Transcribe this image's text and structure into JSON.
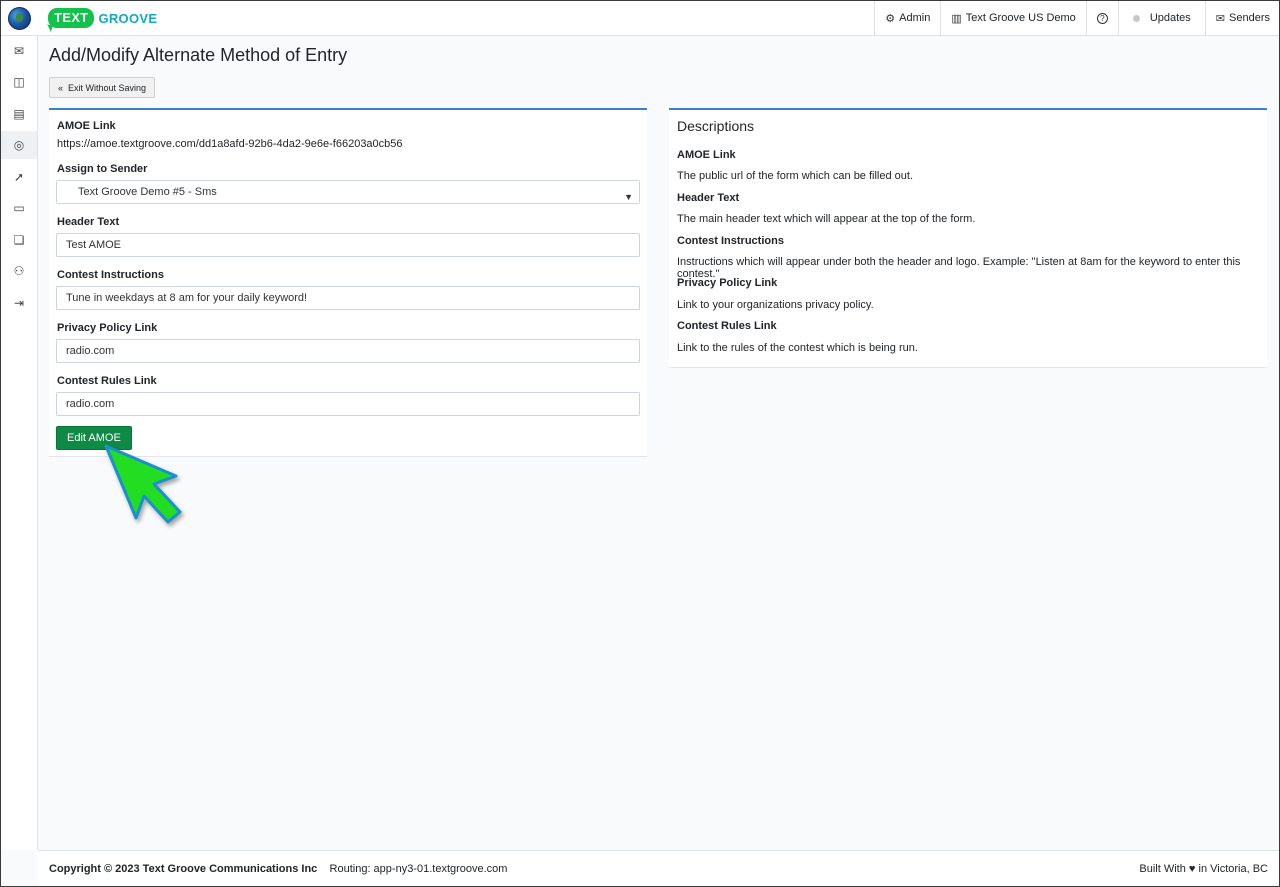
{
  "brand": {
    "logo_badge": "TEXT",
    "logo_word": "GROOVE"
  },
  "topnav": {
    "admin": "Admin",
    "account": "Text Groove US Demo",
    "updates": "Updates",
    "senders": "Senders"
  },
  "sidebar_icons": [
    "inbox-icon",
    "columns-icon",
    "contacts-icon",
    "dashboard-icon",
    "broadcast-icon",
    "message-icon",
    "chat-icon",
    "user-settings-icon",
    "logout-icon"
  ],
  "page": {
    "title": "Add/Modify Alternate Method of Entry",
    "exit_label": "Exit Without Saving"
  },
  "form": {
    "amoe_link_label": "AMOE Link",
    "amoe_link_value": "https://amoe.textgroove.com/dd1a8afd-92b6-4da2-9e6e-f66203a0cb56",
    "sender_label": "Assign to Sender",
    "sender_value": "Text Groove Demo #5 - Sms",
    "header_label": "Header Text",
    "header_value": "Test AMOE",
    "instructions_label": "Contest Instructions",
    "instructions_value": "Tune in weekdays at 8 am for your daily keyword!",
    "privacy_label": "Privacy Policy Link",
    "privacy_value": "radio.com",
    "rules_label": "Contest Rules Link",
    "rules_value": "radio.com",
    "submit_label": "Edit AMOE"
  },
  "descriptions": {
    "title": "Descriptions",
    "items": [
      {
        "heading": "AMOE Link",
        "text": "The public url of the form which can be filled out."
      },
      {
        "heading": "Header Text",
        "text": "The main header text which will appear at the top of the form."
      },
      {
        "heading": "Contest Instructions",
        "text": "Instructions which will appear under both the header and logo. Example: \"Listen at 8am for the keyword to enter this contest.\""
      },
      {
        "heading": "Privacy Policy Link",
        "text": "Link to your organizations privacy policy."
      },
      {
        "heading": "Contest Rules Link",
        "text": "Link to the rules of the contest which is being run."
      }
    ]
  },
  "footer": {
    "copyright": "Copyright © 2023  Text Groove Communications Inc",
    "routing": "Routing: app-ny3-01.textgroove.com",
    "built": "Built With ♥ in Victoria, BC"
  },
  "colors": {
    "accent": "#3b82c4",
    "primary_button": "#0d8a43",
    "brand_green": "#12c24a",
    "brand_teal": "#12a8c8",
    "cursor": "#22dd22"
  }
}
